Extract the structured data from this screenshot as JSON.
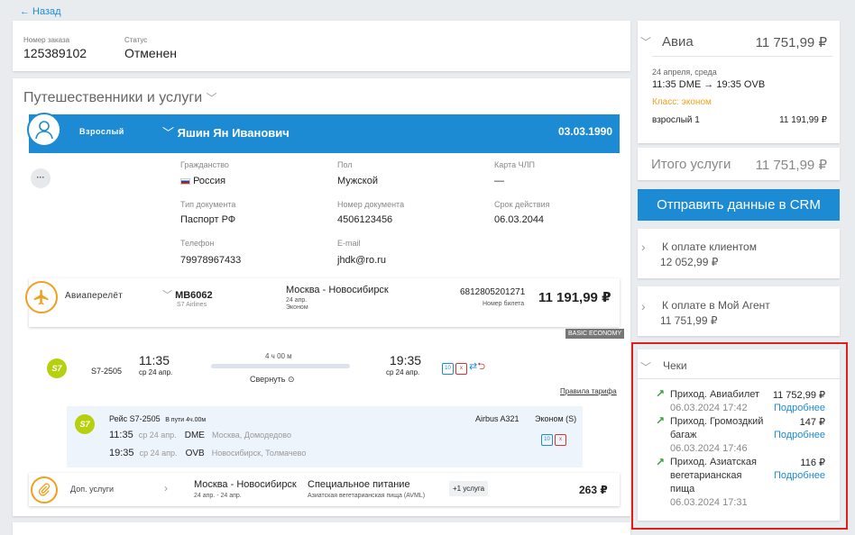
{
  "nav": {
    "back_label": "← Назад"
  },
  "order": {
    "number_label": "Номер заказа",
    "number": "125389102",
    "status_label": "Статус",
    "status": "Отменен"
  },
  "travellers": {
    "title": "Путешественники и услуги",
    "passenger": {
      "type": "Взрослый",
      "name": "Яшин Ян Иванович",
      "birthdate": "03.03.1990",
      "more_label": "···",
      "fields": {
        "citizenship_label": "Гражданство",
        "citizenship": "Россия",
        "gender_label": "Пол",
        "gender": "Мужской",
        "loyalty_label": "Карта ЧЛП",
        "loyalty": "—",
        "doc_type_label": "Тип документа",
        "doc_type": "Паспорт РФ",
        "doc_number_label": "Номер документа",
        "doc_number": "4506123456",
        "expiry_label": "Срок действия",
        "expiry": "06.03.2044",
        "phone_label": "Телефон",
        "phone": "79978967433",
        "email_label": "E-mail",
        "email": "jhdk@ro.ru"
      }
    },
    "flight": {
      "type_label": "Авиаперелёт",
      "code": "MB6062",
      "airline": "S7 Airlines",
      "route": "Москва - Новосибирск",
      "date": "24 апр.",
      "class": "Эконом",
      "ticket_number": "6812805201271",
      "ticket_label": "Номер билета",
      "price": "11 191,99 ₽",
      "fare_badge": "BASIC ECONOMY",
      "segment_summary": {
        "airline_logo": "S7",
        "flight_no": "S7-2505",
        "dep_time": "11:35",
        "dep_date": "ср 24 апр.",
        "duration": "4 ч 00 м",
        "collapse_label": "Свернуть ⊙",
        "arr_time": "19:35",
        "arr_date": "ср 24 апр.",
        "fare_rules_link": "Правила тарифа"
      },
      "segment_detail": {
        "airline_logo": "S7",
        "flight_label": "Рейс S7-2505",
        "in_transit": "В пути 4ч.00м",
        "aircraft": "Airbus A321",
        "cabin": "Эконом (S)",
        "dep_time": "11:35",
        "dep_date": "ср 24 апр.",
        "dep_code": "DME",
        "dep_airport": "Москва, Домодедово",
        "arr_time": "19:35",
        "arr_date": "ср 24 апр.",
        "arr_code": "OVB",
        "arr_airport": "Новосибирск, Толмачево"
      },
      "bag_hand": "10",
      "bag_check": "x"
    },
    "extras": {
      "type_label": "Доп. услуги",
      "route": "Москва - Новосибирск",
      "dates": "24 апр. - 24 апр.",
      "service": "Специальное питание",
      "service_detail": "Азиатская вегетарианская пища (AVML)",
      "count_badge": "+1 услуга",
      "price": "263 ₽"
    }
  },
  "summary": {
    "avia_label": "Авиа",
    "avia_total": "11 751,99 ₽",
    "date": "24 апреля, среда",
    "dep": "11:35 DME",
    "arrow": "→",
    "arr": "19:35 OVB",
    "class": "Класс: эконом",
    "adult_label": "взрослый 1",
    "adult_price": "11 191,99 ₽",
    "services_label": "Итого услуги",
    "services_total": "11 751,99 ₽",
    "crm_button": "Отправить данные в CRM",
    "client_label": "К оплате клиентом",
    "client_amount": "12 052,99 ₽",
    "agent_label": "К оплате в Мой Агент",
    "agent_amount": "11 751,99 ₽"
  },
  "checks": {
    "title": "Чеки",
    "items": [
      {
        "title_line1": "Приход. Авиабилет",
        "title_line2": "",
        "title_line3": "",
        "amount": "11 752,99 ₽",
        "more": "Подробнее",
        "date": "06.03.2024 17:42"
      },
      {
        "title_line1": "Приход. Громоздкий",
        "title_line2": "багаж",
        "title_line3": "",
        "amount": "147 ₽",
        "more": "Подробнее",
        "date": "06.03.2024 17:46"
      },
      {
        "title_line1": "Приход. Азиатская",
        "title_line2": "вегетарианская",
        "title_line3": "пища",
        "amount": "116 ₽",
        "more": "Подробнее",
        "date": "06.03.2024 17:31"
      }
    ]
  },
  "colors": {
    "accent": "#1d8bd3",
    "highlight": "#e0201c",
    "success": "#3a9d3a",
    "class_orange": "#f0a020"
  }
}
